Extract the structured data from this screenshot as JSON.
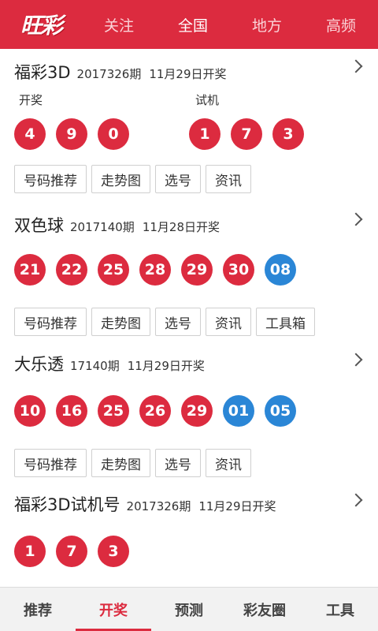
{
  "header": {
    "logo_text": "旺彩",
    "tabs": [
      "关注",
      "全国",
      "地方",
      "高频"
    ],
    "active_tab": "全国"
  },
  "sections": [
    {
      "title": "福彩3D",
      "issue": "2017326期",
      "date": "11月29日开奖",
      "label_left": "开奖",
      "label_right": "试机",
      "balls_left": [
        "4",
        "9",
        "0"
      ],
      "balls_right": [
        "1",
        "7",
        "3"
      ],
      "buttons": [
        "号码推荐",
        "走势图",
        "选号",
        "资讯"
      ]
    },
    {
      "title": "双色球",
      "issue": "2017140期",
      "date": "11月28日开奖",
      "red_balls": [
        "21",
        "22",
        "25",
        "28",
        "29",
        "30"
      ],
      "blue_balls": [
        "08"
      ],
      "buttons": [
        "号码推荐",
        "走势图",
        "选号",
        "资讯",
        "工具箱"
      ]
    },
    {
      "title": "大乐透",
      "issue": "17140期",
      "date": "11月29日开奖",
      "red_balls": [
        "10",
        "16",
        "25",
        "26",
        "29"
      ],
      "blue_balls": [
        "01",
        "05"
      ],
      "buttons": [
        "号码推荐",
        "走势图",
        "选号",
        "资讯"
      ]
    },
    {
      "title": "福彩3D试机号",
      "issue": "2017326期",
      "date": "11月29日开奖",
      "red_balls": [
        "1",
        "7",
        "3"
      ]
    }
  ],
  "bottom_tabs": [
    "推荐",
    "开奖",
    "预测",
    "彩友圈",
    "工具"
  ],
  "active_bottom_tab": "开奖",
  "colors": {
    "brand_red": "#dc2b3f",
    "ball_blue": "#2a86d6"
  }
}
